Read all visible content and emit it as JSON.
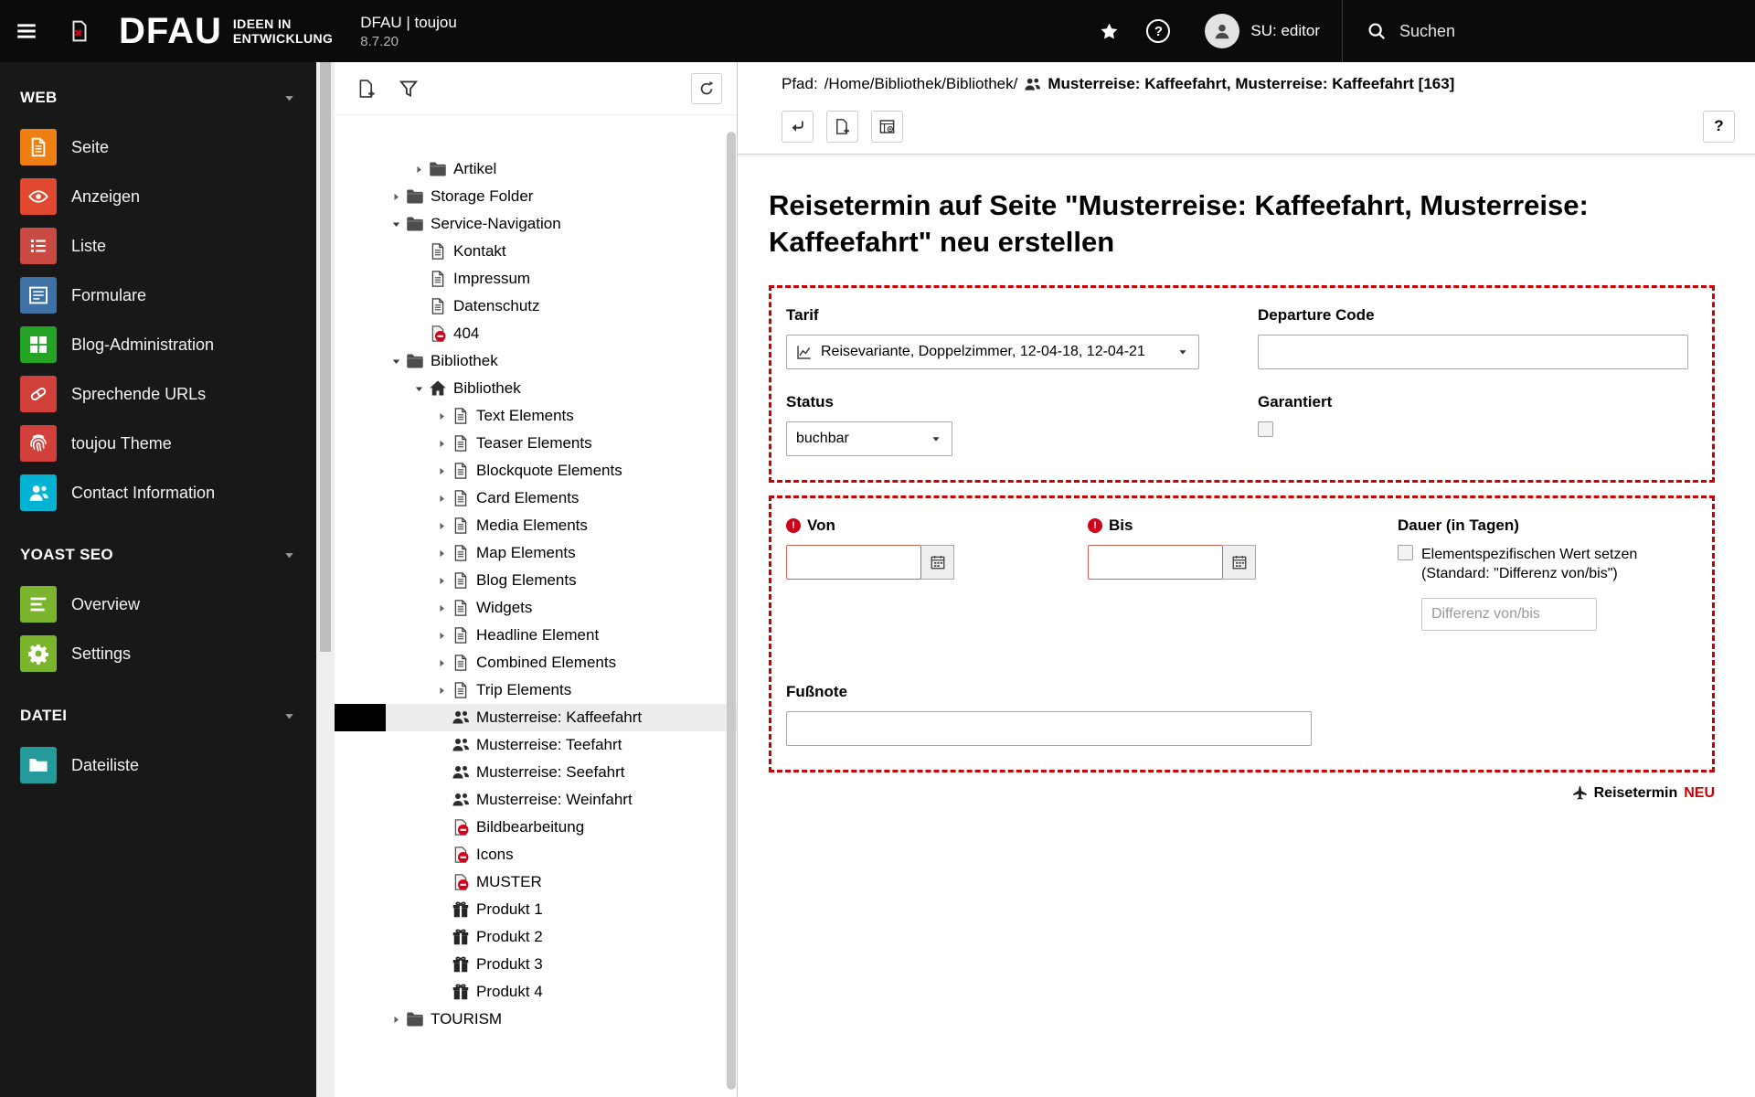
{
  "topbar": {
    "logo": {
      "brand": "DFAU",
      "tag1": "IDEEN IN",
      "tag2": "ENTWICKLUNG"
    },
    "site": {
      "name": "DFAU | toujou",
      "version": "8.7.20"
    },
    "user": {
      "name": "SU: editor"
    },
    "search": {
      "label": "Suchen"
    }
  },
  "sidebar": {
    "sections": [
      {
        "label": "WEB",
        "items": [
          {
            "label": "Seite",
            "icon": "doc-module-icon",
            "color": "#ee7f13"
          },
          {
            "label": "Anzeigen",
            "icon": "eye-icon",
            "color": "#e0492f"
          },
          {
            "label": "Liste",
            "icon": "list-icon",
            "color": "#c94a42"
          },
          {
            "label": "Formulare",
            "icon": "form-icon",
            "color": "#3f72a4"
          },
          {
            "label": "Blog-Administration",
            "icon": "grid-icon",
            "color": "#25a325"
          },
          {
            "label": "Sprechende URLs",
            "icon": "pill-icon",
            "color": "#d2403c"
          },
          {
            "label": "toujou Theme",
            "icon": "fingerprint-icon",
            "color": "#d2403c"
          },
          {
            "label": "Contact Information",
            "icon": "contact-icon",
            "color": "#00b3d3"
          }
        ]
      },
      {
        "label": "YOAST SEO",
        "items": [
          {
            "label": "Overview",
            "icon": "bars-icon",
            "color": "#7bb42d"
          },
          {
            "label": "Settings",
            "icon": "gear-icon",
            "color": "#7bb42d"
          }
        ]
      },
      {
        "label": "DATEI",
        "items": [
          {
            "label": "Dateiliste",
            "icon": "files-icon",
            "color": "#259a9a"
          }
        ]
      }
    ]
  },
  "tree": {
    "items": [
      {
        "label": "Artikel",
        "level": 2,
        "chevron": "right",
        "icon": "folder-icon"
      },
      {
        "label": "Storage Folder",
        "level": 1,
        "chevron": "right",
        "icon": "folder-icon"
      },
      {
        "label": "Service-Navigation",
        "level": 1,
        "chevron": "down",
        "icon": "folder-icon"
      },
      {
        "label": "Kontakt",
        "level": 2,
        "chevron": null,
        "icon": "page-icon"
      },
      {
        "label": "Impressum",
        "level": 2,
        "chevron": null,
        "icon": "page-icon"
      },
      {
        "label": "Datenschutz",
        "level": 2,
        "chevron": null,
        "icon": "page-icon"
      },
      {
        "label": "404",
        "level": 2,
        "chevron": null,
        "icon": "page-error-icon"
      },
      {
        "label": "Bibliothek",
        "level": 1,
        "chevron": "down",
        "icon": "folder-icon"
      },
      {
        "label": "Bibliothek",
        "level": 2,
        "chevron": "down",
        "icon": "home-icon"
      },
      {
        "label": "Text Elements",
        "level": 3,
        "chevron": "right",
        "icon": "page-icon"
      },
      {
        "label": "Teaser Elements",
        "level": 3,
        "chevron": "right",
        "icon": "page-icon"
      },
      {
        "label": "Blockquote Elements",
        "level": 3,
        "chevron": "right",
        "icon": "page-icon"
      },
      {
        "label": "Card Elements",
        "level": 3,
        "chevron": "right",
        "icon": "page-icon"
      },
      {
        "label": "Media Elements",
        "level": 3,
        "chevron": "right",
        "icon": "page-icon"
      },
      {
        "label": "Map Elements",
        "level": 3,
        "chevron": "right",
        "icon": "page-icon"
      },
      {
        "label": "Blog Elements",
        "level": 3,
        "chevron": "right",
        "icon": "page-icon"
      },
      {
        "label": "Widgets",
        "level": 3,
        "chevron": "right",
        "icon": "page-icon"
      },
      {
        "label": "Headline Element",
        "level": 3,
        "chevron": "right",
        "icon": "page-icon"
      },
      {
        "label": "Combined Elements",
        "level": 3,
        "chevron": "right",
        "icon": "page-icon"
      },
      {
        "label": "Trip Elements",
        "level": 3,
        "chevron": "right",
        "icon": "page-icon"
      },
      {
        "label": "Musterreise: Kaffeefahrt",
        "level": 3,
        "chevron": null,
        "icon": "users-icon",
        "selected": true
      },
      {
        "label": "Musterreise: Teefahrt",
        "level": 3,
        "chevron": null,
        "icon": "users-icon"
      },
      {
        "label": "Musterreise: Seefahrt",
        "level": 3,
        "chevron": null,
        "icon": "users-icon"
      },
      {
        "label": "Musterreise: Weinfahrt",
        "level": 3,
        "chevron": null,
        "icon": "users-icon"
      },
      {
        "label": "Bildbearbeitung",
        "level": 3,
        "chevron": null,
        "icon": "page-error-icon"
      },
      {
        "label": "Icons",
        "level": 3,
        "chevron": null,
        "icon": "page-error-icon"
      },
      {
        "label": "MUSTER",
        "level": 3,
        "chevron": null,
        "icon": "page-error-icon"
      },
      {
        "label": "Produkt 1",
        "level": 3,
        "chevron": null,
        "icon": "gift-icon"
      },
      {
        "label": "Produkt 2",
        "level": 3,
        "chevron": null,
        "icon": "gift-icon"
      },
      {
        "label": "Produkt 3",
        "level": 3,
        "chevron": null,
        "icon": "gift-icon"
      },
      {
        "label": "Produkt 4",
        "level": 3,
        "chevron": null,
        "icon": "gift-icon"
      },
      {
        "label": "TOURISM",
        "level": 1,
        "chevron": "right",
        "icon": "folder-icon"
      }
    ]
  },
  "docheader": {
    "path_label": "Pfad:",
    "path_value": "/Home/Bibliothek/Bibliothek/",
    "record_title": "Musterreise: Kaffeefahrt, Musterreise: Kaffeefahrt [163]"
  },
  "content": {
    "heading": "Reisetermin auf Seite \"Musterreise: Kaffeefahrt, Musterreise: Kaffeefahrt\" neu erstellen",
    "form": {
      "tarif": {
        "label": "Tarif",
        "value": "Reisevariante, Doppelzimmer, 12-04-18, 12-04-21"
      },
      "departure_code": {
        "label": "Departure Code",
        "value": ""
      },
      "status": {
        "label": "Status",
        "value": "buchbar"
      },
      "garantiert": {
        "label": "Garantiert",
        "checked": false
      },
      "von": {
        "label": "Von",
        "value": ""
      },
      "bis": {
        "label": "Bis",
        "value": ""
      },
      "dauer": {
        "label": "Dauer (in Tagen)",
        "checkbox_label_1": "Elementspezifischen Wert setzen",
        "checkbox_label_2": "(Standard: \"Differenz von/bis\")",
        "placeholder": "Differenz von/bis",
        "value": ""
      },
      "fussnote": {
        "label": "Fußnote",
        "value": ""
      }
    },
    "footer": {
      "type_label": "Reisetermin",
      "badge": "NEU"
    },
    "accent_red": "#cc0000"
  }
}
